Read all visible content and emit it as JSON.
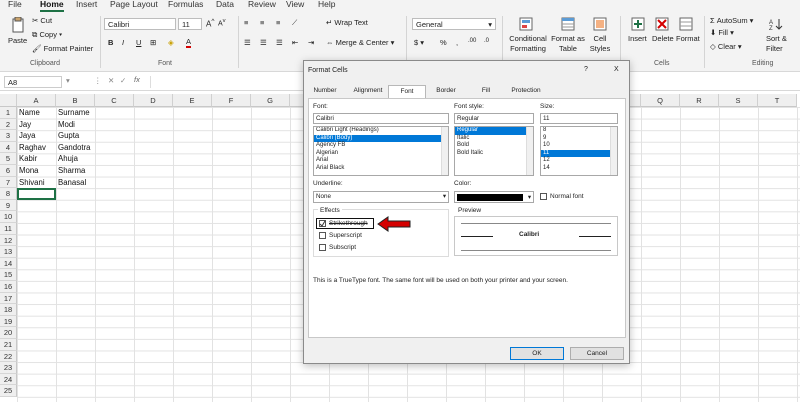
{
  "tabs": [
    "File",
    "Home",
    "Insert",
    "Page Layout",
    "Formulas",
    "Data",
    "Review",
    "View",
    "Help"
  ],
  "clipboard": {
    "paste": "Paste",
    "cut": "Cut",
    "copy": "Copy",
    "format_painter": "Format Painter",
    "label": "Clipboard"
  },
  "font_group": {
    "font_name": "Calibri",
    "font_size": "11",
    "label": "Font"
  },
  "alignment": {
    "wrap_text": "Wrap Text",
    "merge_center": "Merge & Center"
  },
  "number": {
    "format": "General"
  },
  "styles": {
    "conditional": "Conditional",
    "conditional2": "Formatting",
    "format_as": "Format as",
    "format_as2": "Table",
    "cell": "Cell",
    "cell2": "Styles"
  },
  "cells_group": {
    "insert": "Insert",
    "delete": "Delete",
    "format": "Format",
    "label": "Cells"
  },
  "editing": {
    "autosum": "AutoSum",
    "fill": "Fill",
    "clear": "Clear",
    "sort": "Sort &",
    "sort2": "Filter",
    "label": "Editing"
  },
  "formula_bar": {
    "name_box": "A8",
    "fx": "fx",
    "content": ""
  },
  "columns": [
    "A",
    "B",
    "C",
    "D",
    "E",
    "F",
    "G",
    "H",
    "I",
    "J",
    "K",
    "L",
    "M",
    "N",
    "O",
    "P",
    "Q",
    "R",
    "S",
    "T"
  ],
  "rows": [
    "1",
    "2",
    "3",
    "4",
    "5",
    "6",
    "7",
    "8",
    "9",
    "10",
    "11",
    "12",
    "13",
    "14",
    "15",
    "16",
    "17",
    "18",
    "19",
    "20",
    "21",
    "22",
    "23",
    "24",
    "25"
  ],
  "sheet_data": [
    [
      "Name",
      "Surname"
    ],
    [
      "Jay",
      "Modi"
    ],
    [
      "Jaya",
      "Gupta"
    ],
    [
      "Raghav",
      "Gandotra"
    ],
    [
      "Kabir",
      "Ahuja"
    ],
    [
      "Mona",
      "Sharma"
    ],
    [
      "Shivani",
      "Banasal"
    ]
  ],
  "dialog": {
    "title": "Format Cells",
    "help": "?",
    "close": "X",
    "tabs": [
      "Number",
      "Alignment",
      "Font",
      "Border",
      "Fill",
      "Protection"
    ],
    "font_label": "Font:",
    "font_value": "Calibri",
    "font_list": [
      "Calibri Light (Headings)",
      "Calibri (Body)",
      "Agency FB",
      "Algerian",
      "Arial",
      "Arial Black"
    ],
    "style_label": "Font style:",
    "style_value": "Regular",
    "style_list": [
      "Regular",
      "Italic",
      "Bold",
      "Bold Italic"
    ],
    "size_label": "Size:",
    "size_value": "11",
    "size_list": [
      "8",
      "9",
      "10",
      "11",
      "12",
      "14"
    ],
    "underline_label": "Underline:",
    "underline_value": "None",
    "color_label": "Color:",
    "normal_font": "Normal font",
    "effects_label": "Effects",
    "strikethrough": "Strikethrough",
    "superscript": "Superscript",
    "subscript": "Subscript",
    "preview_label": "Preview",
    "preview_text": "Calibri",
    "info": "This is a TrueType font.  The same font will be used on both your printer and your screen.",
    "ok": "OK",
    "cancel": "Cancel"
  },
  "colors": {
    "excel_green": "#1e7145",
    "selection_blue": "#0078d7",
    "arrow_red": "#d40000"
  }
}
